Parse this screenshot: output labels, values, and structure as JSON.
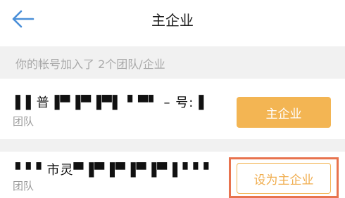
{
  "header": {
    "title": "主企业"
  },
  "notice": {
    "text": "你的帐号加入了 2个团队/企业"
  },
  "orgs": [
    {
      "name": "▌▌普▐▀▐▀▐▀▌ ▘▀▘ – 号:▐",
      "type": "团队",
      "action": "主企业"
    },
    {
      "name": "▘▘▘市灵▀▐▀▐▀▐▀▐▀▐ ▘▘▘",
      "type": "团队",
      "action": "设为主企业"
    }
  ],
  "colors": {
    "accent": "#f3b553",
    "highlight": "#e8734e",
    "back_arrow": "#4a8fd8"
  },
  "icons": {
    "back": "back-arrow-icon"
  }
}
